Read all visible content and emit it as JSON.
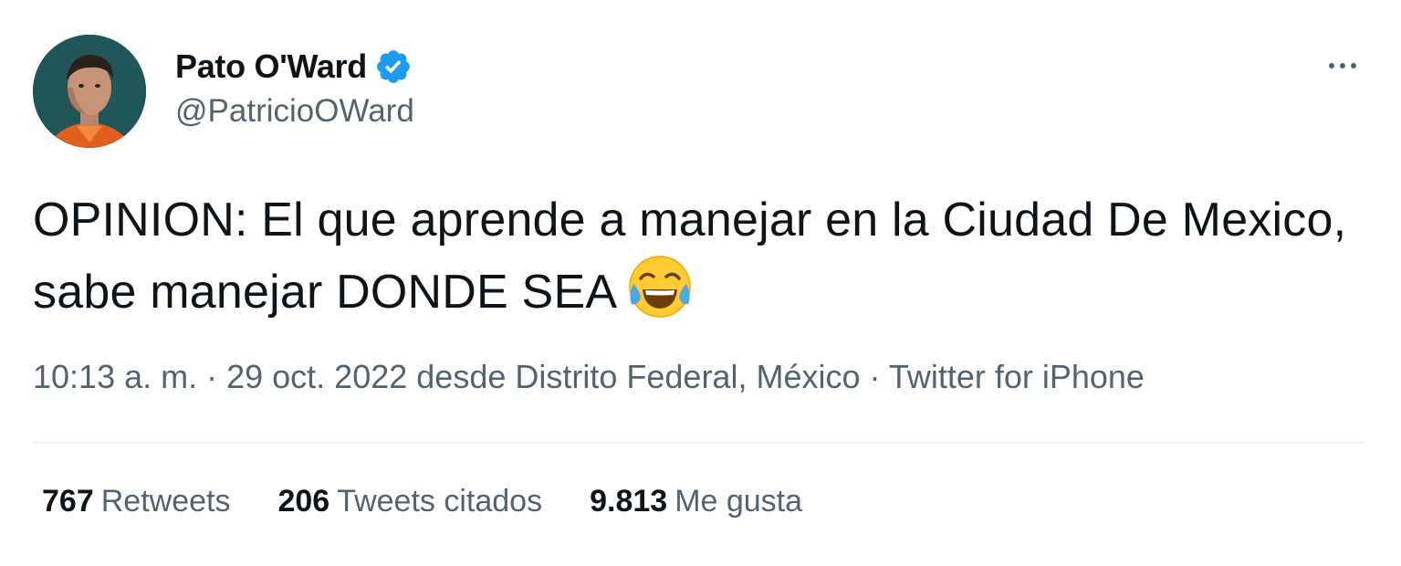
{
  "author": {
    "name": "Pato O'Ward",
    "handle": "@PatricioOWard",
    "verified": true,
    "verified_color": "#1d9bf0"
  },
  "tweet": {
    "text": "OPINION: El que aprende a manejar en la Ciudad De Mexico, sabe manejar DONDE SEA",
    "emoji": "face-with-tears-of-joy"
  },
  "meta": {
    "time": "10:13 a. m.",
    "separator": " · ",
    "date": "29 oct. 2022",
    "from_text": " desde ",
    "location": "Distrito Federal, México",
    "source": "Twitter for iPhone"
  },
  "stats": {
    "retweets": {
      "count": "767",
      "label": "Retweets"
    },
    "quotes": {
      "count": "206",
      "label": "Tweets citados"
    },
    "likes": {
      "count": "9.813",
      "label": "Me gusta"
    }
  },
  "colors": {
    "text": "#0f1419",
    "secondary": "#536471",
    "divider": "#eff3f4"
  }
}
